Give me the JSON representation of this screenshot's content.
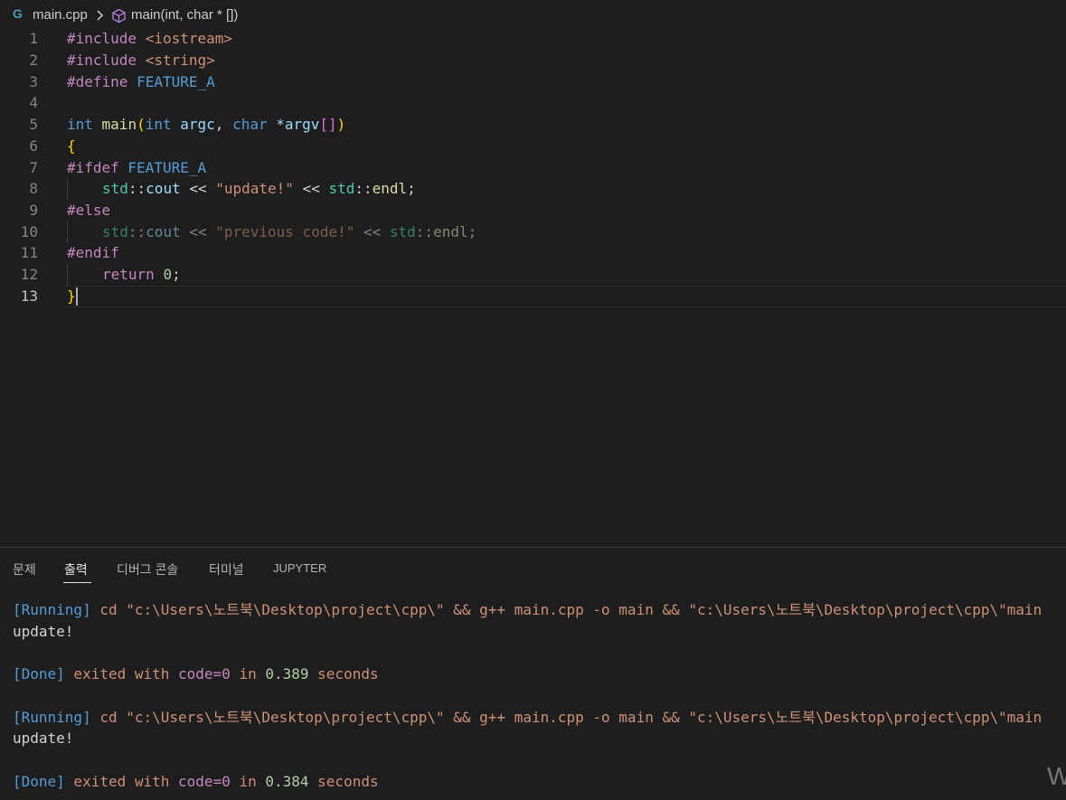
{
  "breadcrumb": {
    "file": "main.cpp",
    "symbol": "main(int, char * [])"
  },
  "editor": {
    "line_numbers": [
      "1",
      "2",
      "3",
      "4",
      "5",
      "6",
      "7",
      "8",
      "9",
      "10",
      "11",
      "12",
      "13"
    ],
    "active_line": "13",
    "lines": {
      "l1": {
        "a": "#include",
        "b": " <iostream>"
      },
      "l2": {
        "a": "#include",
        "b": " <string>"
      },
      "l3": {
        "a": "#define",
        "b": " FEATURE_A"
      },
      "l5": {
        "t1": "int",
        "t2": " main",
        "t3": "(",
        "t4": "int",
        "t5": " argc",
        "t6": ", ",
        "t7": "char",
        "t8": " *",
        "t9": "argv",
        "t10": "[]",
        "t11": ")"
      },
      "l6": {
        "a": "{"
      },
      "l7": {
        "a": "#ifdef",
        "b": " FEATURE_A"
      },
      "l8": {
        "a": "std",
        "b": "::",
        "c": "cout",
        "d": " << ",
        "e": "\"update!\"",
        "f": " << ",
        "g": "std",
        "h": "::",
        "i": "endl",
        "j": ";"
      },
      "l9": {
        "a": "#else"
      },
      "l10": {
        "a": "std",
        "b": "::",
        "c": "cout",
        "d": " << ",
        "e": "\"previous code!\"",
        "f": " << ",
        "g": "std",
        "h": "::",
        "i": "endl",
        "j": ";"
      },
      "l11": {
        "a": "#endif"
      },
      "l12": {
        "a": "return",
        "b": " ",
        "c": "0",
        "d": ";"
      },
      "l13": {
        "a": "}"
      }
    }
  },
  "panel": {
    "tabs": [
      "문제",
      "출력",
      "디버그 콘솔",
      "터미널",
      "JUPYTER"
    ],
    "active_tab": "출력",
    "output": [
      {
        "tag": "[Running]",
        "cmd": " cd \"c:\\Users\\노트북\\Desktop\\project\\cpp\\\" && g++ main.cpp -o main && \"c:\\Users\\노트북\\Desktop\\project\\cpp\\\"main"
      },
      {
        "text": "update!"
      },
      {
        "tag": "[Done]",
        "p1": " exited with ",
        "code": "code=0",
        "p2": " in ",
        "num": "0.389",
        "sec": " seconds"
      },
      {
        "tag": "[Running]",
        "cmd": " cd \"c:\\Users\\노트북\\Desktop\\project\\cpp\\\" && g++ main.cpp -o main && \"c:\\Users\\노트북\\Desktop\\project\\cpp\\\"main"
      },
      {
        "text": "update!"
      },
      {
        "tag": "[Done]",
        "p1": " exited with ",
        "code": "code=0",
        "p2": " in ",
        "num": "0.384",
        "sec": " seconds"
      }
    ]
  },
  "colors": {
    "background": "#1e1e1e",
    "keyword": "#569cd6",
    "preprocessor": "#c586c0",
    "string": "#ce9178",
    "function": "#dcdcaa",
    "variable": "#9cdcfe",
    "namespace": "#4ec9b0",
    "number": "#b5cea8"
  },
  "icons": [
    "cpp-file-icon",
    "chevron-right-icon",
    "symbol-method-icon"
  ],
  "watermark_fragment": "W"
}
